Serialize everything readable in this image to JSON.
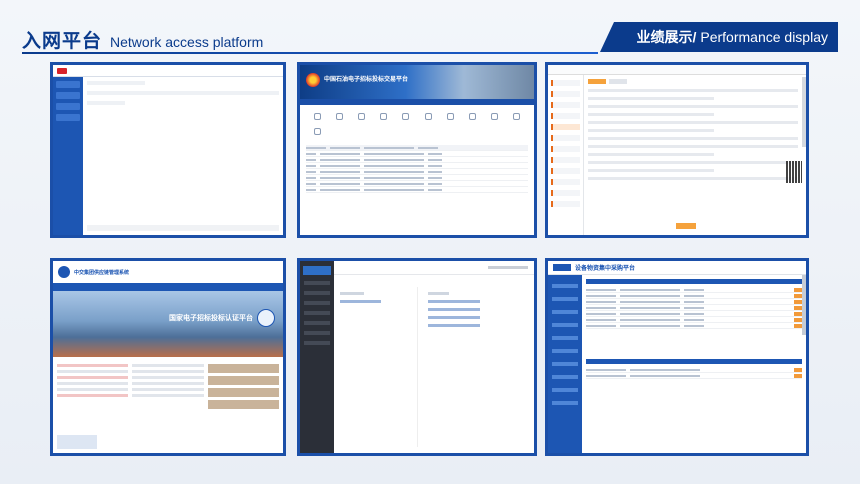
{
  "header": {
    "title_cn": "入网平台",
    "title_en": "Network access platform",
    "section_cn": "业绩展示/",
    "section_en": "Performance display"
  },
  "colors": {
    "brand_blue": "#0b3b8c",
    "panel_border": "#1b4fa8",
    "accent_orange": "#f5a23c"
  },
  "panels": {
    "p2": {
      "banner_title": "中国石油电子招标投标交易平台"
    },
    "p4": {
      "site_title": "中交集团供应链管理系统",
      "hero_text": "国家电子招标投标认证平台"
    },
    "p6": {
      "site_title": "设备物资集中采购平台"
    }
  }
}
